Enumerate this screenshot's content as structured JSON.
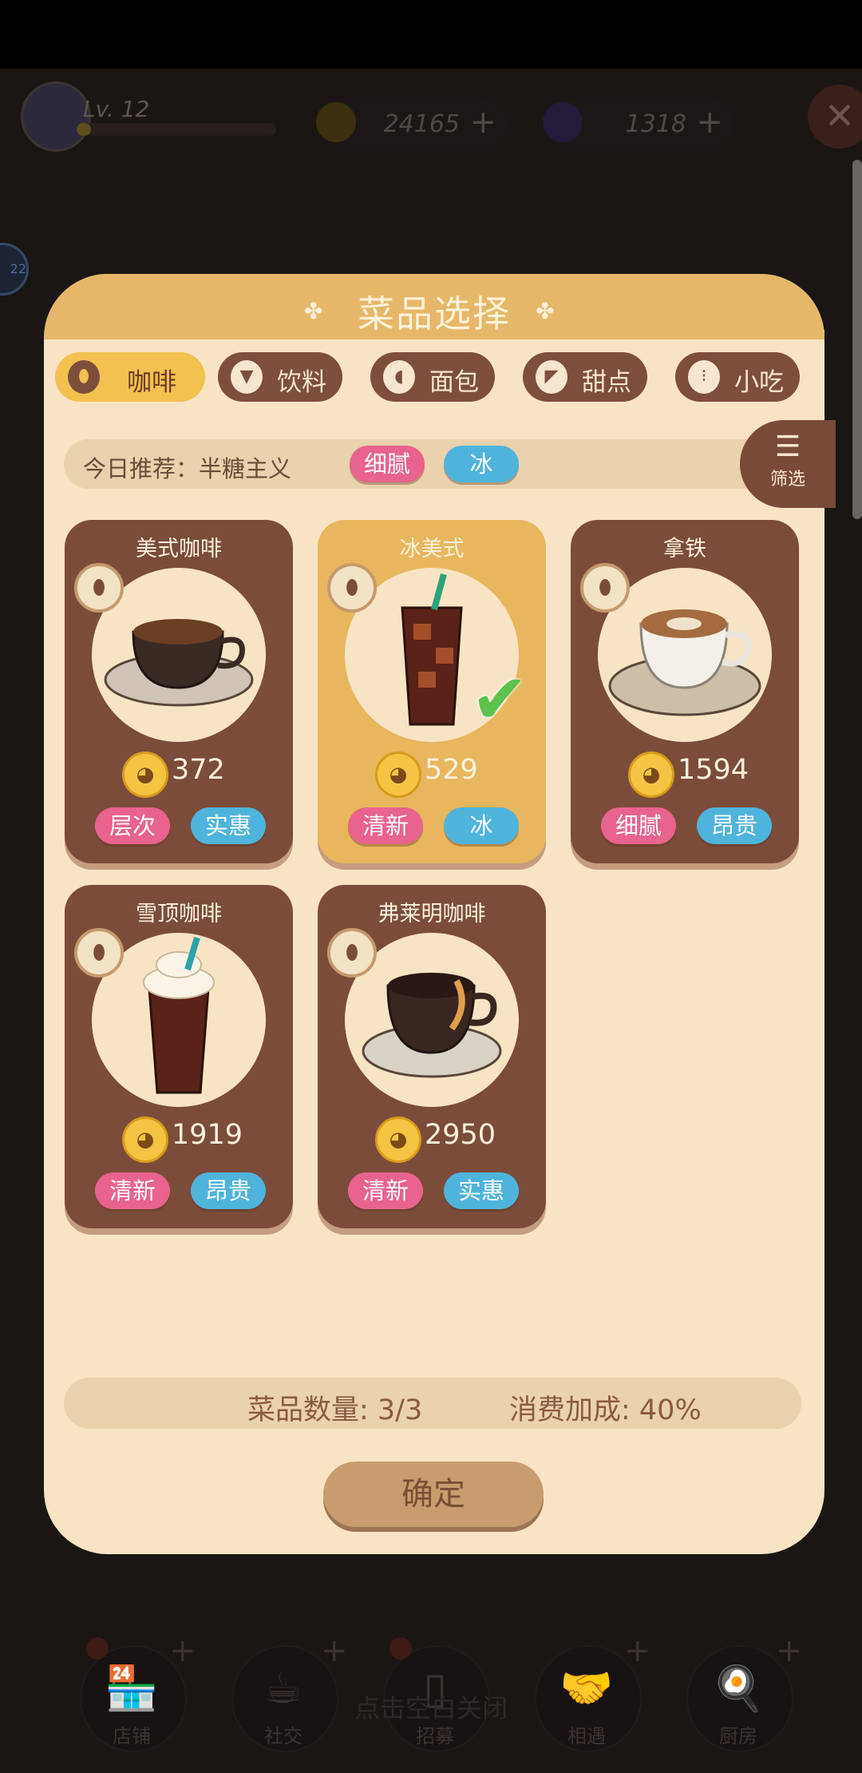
{
  "hud": {
    "level": "Lv. 12",
    "level_progress": 0.05,
    "coins": "24165",
    "gems": "1318",
    "plus": "+",
    "close": "✕",
    "side_badge": "22"
  },
  "modal": {
    "title": "菜品选择",
    "tabs": [
      {
        "label": "咖啡",
        "icon": "coffee-bean-icon",
        "active": true
      },
      {
        "label": "饮料",
        "icon": "drink-icon",
        "active": false
      },
      {
        "label": "面包",
        "icon": "bread-icon",
        "active": false
      },
      {
        "label": "甜点",
        "icon": "dessert-icon",
        "active": false
      },
      {
        "label": "小吃",
        "icon": "skewer-icon",
        "active": false
      }
    ],
    "recommend": {
      "text": "今日推荐：半糖主义",
      "tags": [
        "细腻",
        "冰"
      ]
    },
    "filter_label": "筛选",
    "dishes": [
      {
        "name": "美式咖啡",
        "price": "372",
        "tags": [
          "层次",
          "实惠"
        ],
        "selected": false,
        "icon": "coffee-cup-icon"
      },
      {
        "name": "冰美式",
        "price": "529",
        "tags": [
          "清新",
          "冰"
        ],
        "selected": true,
        "icon": "iced-coffee-icon"
      },
      {
        "name": "拿铁",
        "price": "1594",
        "tags": [
          "细腻",
          "昂贵"
        ],
        "selected": false,
        "icon": "latte-icon"
      },
      {
        "name": "雪顶咖啡",
        "price": "1919",
        "tags": [
          "清新",
          "昂贵"
        ],
        "selected": false,
        "icon": "float-coffee-icon"
      },
      {
        "name": "弗莱明咖啡",
        "price": "2950",
        "tags": [
          "清新",
          "实惠"
        ],
        "selected": false,
        "icon": "flaming-coffee-icon"
      }
    ],
    "stats": {
      "count": "菜品数量: 3/3",
      "bonus": "消费加成: 40%"
    },
    "confirm": "确定"
  },
  "nav": {
    "items": [
      {
        "label": "店铺",
        "icon": "shop-icon"
      },
      {
        "label": "社交",
        "icon": "cup-icon"
      },
      {
        "label": "招募",
        "icon": "door-icon"
      },
      {
        "label": "相遇",
        "icon": "handshake-icon"
      },
      {
        "label": "厨房",
        "icon": "pan-icon"
      }
    ],
    "hint": "点击空白关闭"
  },
  "colors": {
    "modal_bg": "#f8e4c4",
    "header": "#e6b769",
    "card": "#7b4c3a",
    "card_selected": "#e8b65d",
    "tag_pink": "#e8638d",
    "tag_blue": "#4fb4dc"
  }
}
